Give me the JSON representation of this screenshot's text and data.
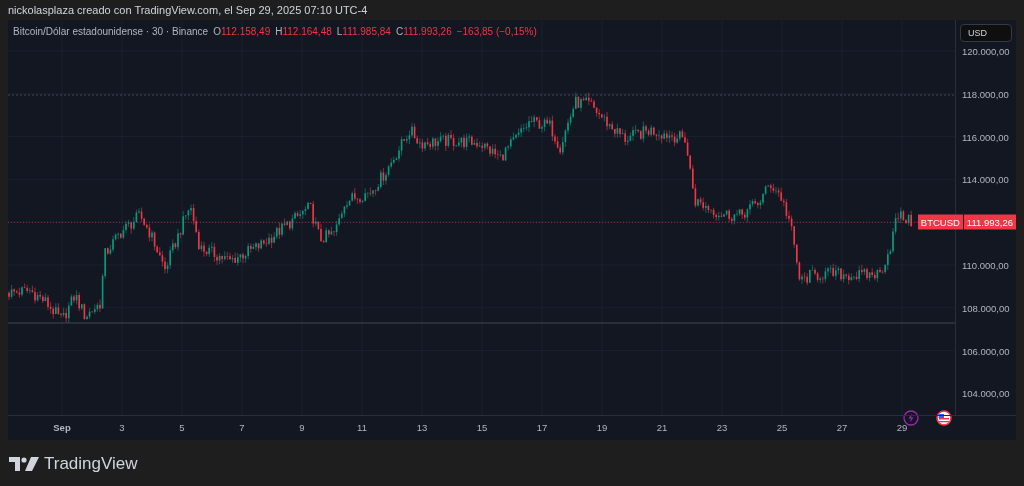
{
  "header": {
    "attribution": "nickolasplaza creado con TradingView.com, el Sep 29, 2025 07:10 UTC-4"
  },
  "legend": {
    "symbol": "Bitcoin/Dólar estadounidense · 30 · Binance",
    "ohlc": [
      {
        "label": "O",
        "value": "112.158,49"
      },
      {
        "label": "H",
        "value": "112.164,48"
      },
      {
        "label": "L",
        "value": "111.985,84"
      },
      {
        "label": "C",
        "value": "111.993,26"
      }
    ],
    "change": "−163,85 (−0,15%)"
  },
  "price_axis": {
    "currency": "USD",
    "ticks": [
      "120.000,00",
      "118.000,00",
      "116.000,00",
      "114.000,00",
      "110.000,00",
      "108.000,00",
      "106.000,00",
      "104.000,00"
    ]
  },
  "last_price": {
    "symbol": "BTCUSD",
    "value": "111.993,26"
  },
  "time_axis": {
    "ticks": [
      "Sep",
      "3",
      "5",
      "7",
      "9",
      "11",
      "13",
      "15",
      "17",
      "19",
      "21",
      "23",
      "25",
      "27",
      "29"
    ]
  },
  "footer": {
    "logo": "TradingView"
  }
}
